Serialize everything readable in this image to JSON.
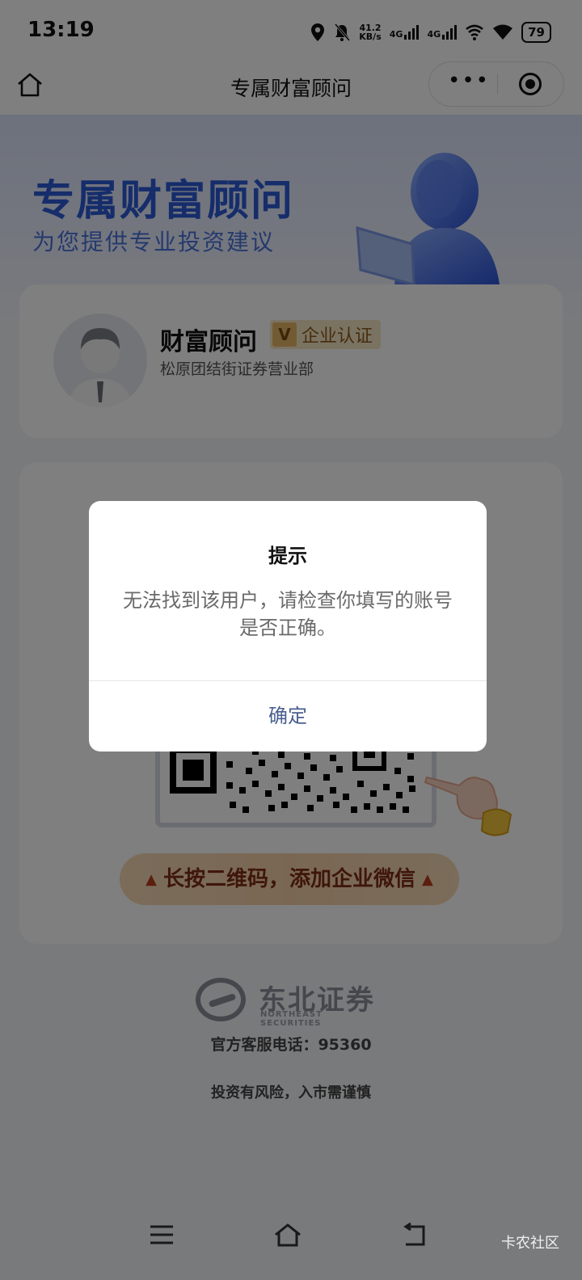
{
  "status_bar": {
    "time": "13:19",
    "net_speed_top": "41.2",
    "net_speed_bottom": "KB/s",
    "sim1": "4G",
    "sim2": "4G",
    "battery": "79"
  },
  "nav": {
    "title": "专属财富顾问",
    "more_label": "•••"
  },
  "hero": {
    "title": "专属财富顾问",
    "subtitle": "为您提供专业投资建议"
  },
  "advisor": {
    "name": "财富顾问",
    "badge_v": "V",
    "badge_text": "企业认证",
    "branch": "松原团结街证券营业部"
  },
  "cta": {
    "text": "长按二维码，添加企业微信",
    "left_mark": "▲",
    "right_mark": "▲"
  },
  "footer": {
    "logo_cn": "东北证券",
    "logo_en": "NORTHEAST SECURITIES",
    "hotline": "官方客服电话：95360",
    "risk": "投资有风险，入市需谨慎"
  },
  "watermark": "卡农社区",
  "dialog": {
    "title": "提示",
    "message": "无法找到该用户，请检查你填写的账号是否正确。",
    "confirm": "确定"
  },
  "colors": {
    "brand_blue": "#2d5ad6",
    "dialog_button": "#4a5f8f",
    "cta_text": "#7e2d16"
  }
}
